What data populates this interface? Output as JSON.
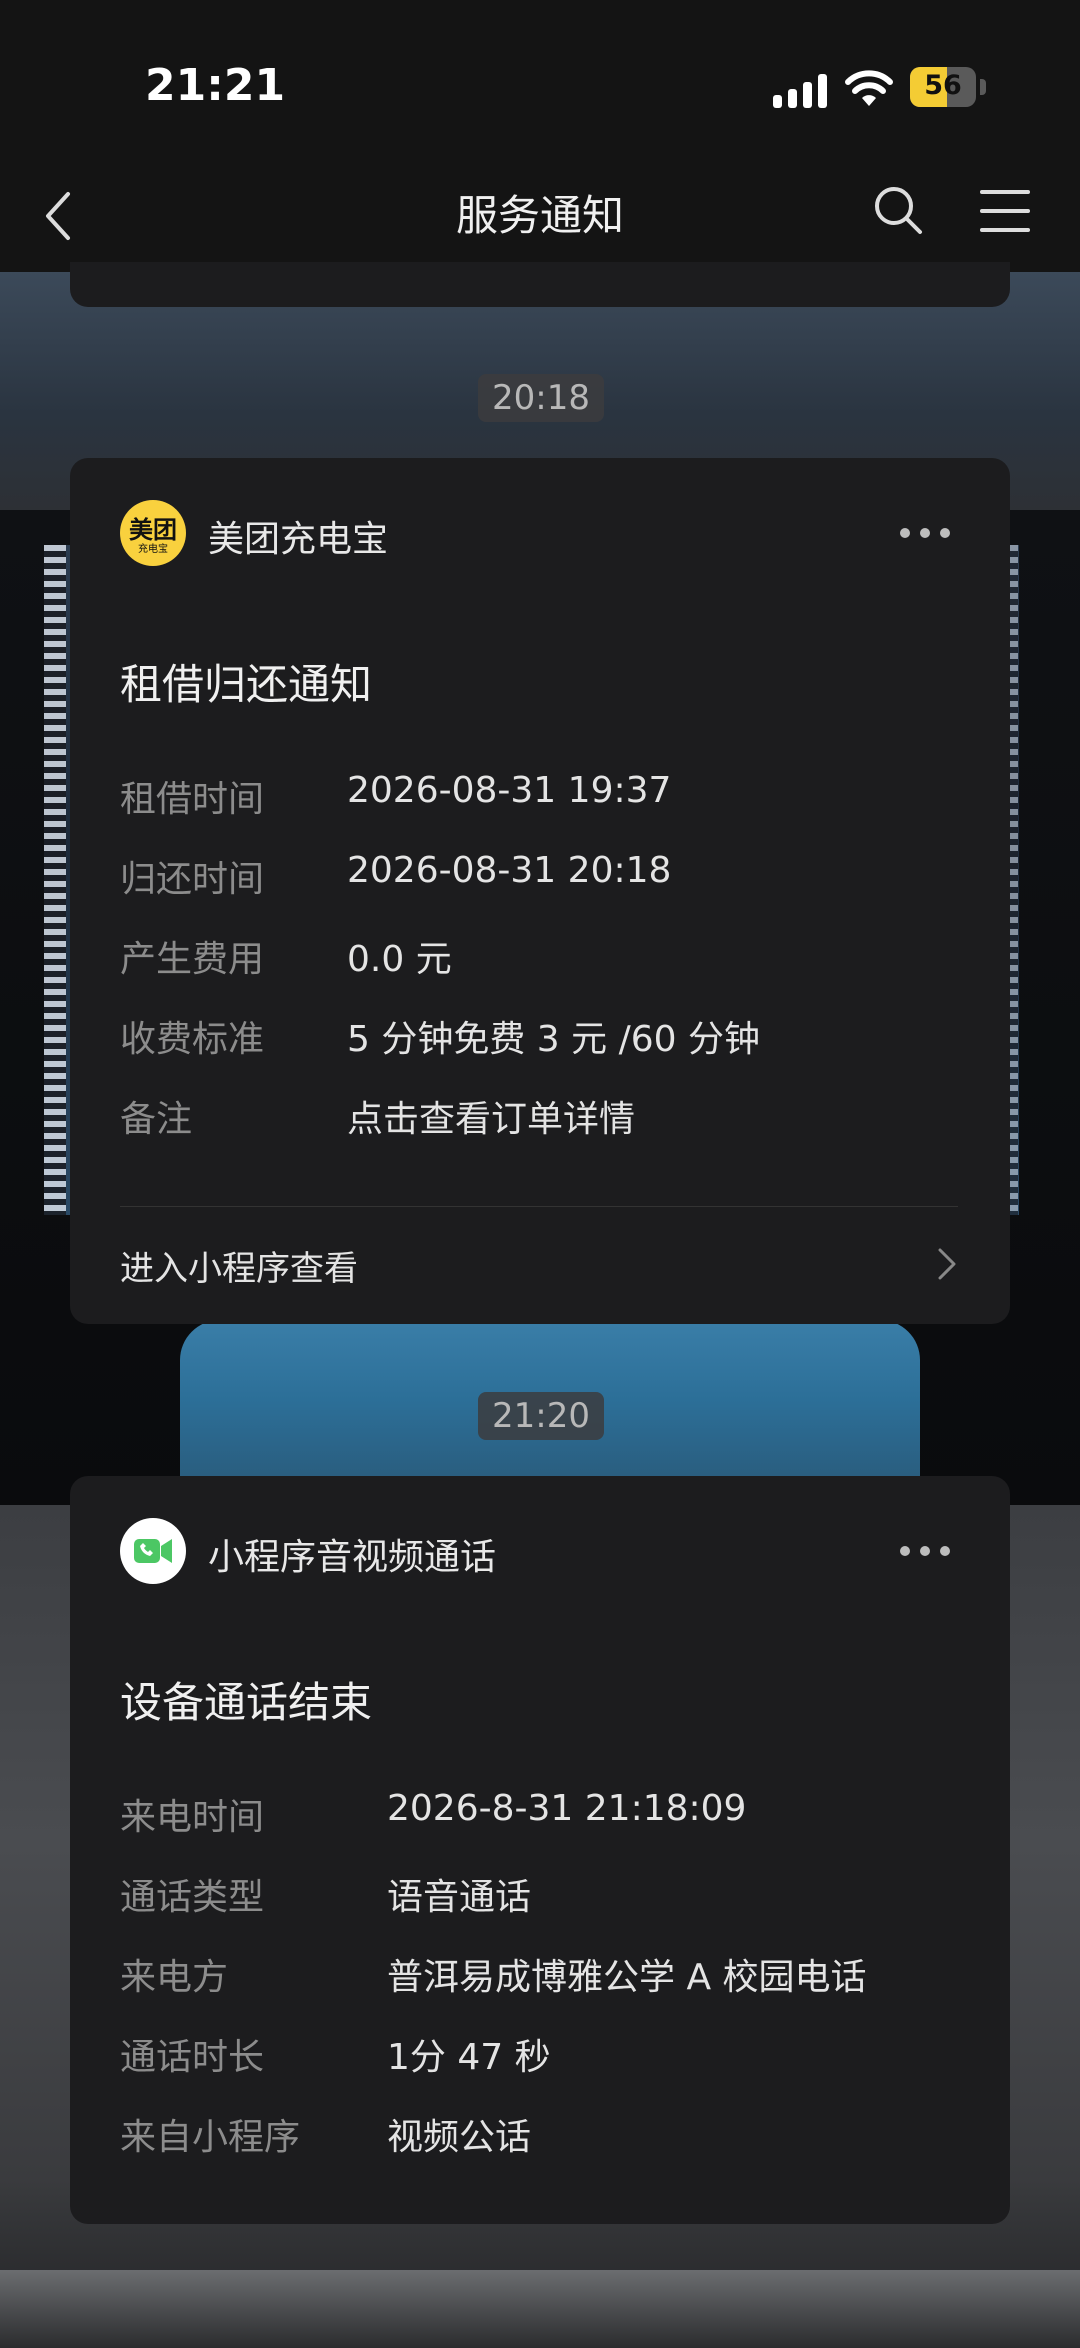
{
  "status_bar": {
    "time": "21:21",
    "battery": "56",
    "battery_level": 0.56
  },
  "nav": {
    "title": "服务通知"
  },
  "timestamps": [
    "20:18",
    "21:20"
  ],
  "cards": [
    {
      "app_name": "美团充电宝",
      "icon_text": "美团",
      "icon_subtext": "充电宝",
      "icon_color": "#f9d13e",
      "title": "租借归还通知",
      "fields": [
        {
          "label": "租借时间",
          "value": "2026-08-31 19:37"
        },
        {
          "label": "归还时间",
          "value": "2026-08-31 20:18"
        },
        {
          "label": "产生费用",
          "value": "0.0 元"
        },
        {
          "label": "收费标准",
          "value": "5 分钟免费 3 元 /60 分钟"
        },
        {
          "label": "备注",
          "value": "点击查看订单详情"
        }
      ],
      "footer_link": "进入小程序查看"
    },
    {
      "app_name": "小程序音视频通话",
      "icon_color": "#4cc764",
      "title": "设备通话结束",
      "fields": [
        {
          "label": "来电时间",
          "value": "2026-8-31 21:18:09"
        },
        {
          "label": "通话类型",
          "value": "语音通话"
        },
        {
          "label": "来电方",
          "value": "普洱易成博雅公学 A 校园电话"
        },
        {
          "label": "通话时长",
          "value": "1分 47 秒"
        },
        {
          "label": "来自小程序",
          "value": "视频公话"
        }
      ]
    }
  ]
}
